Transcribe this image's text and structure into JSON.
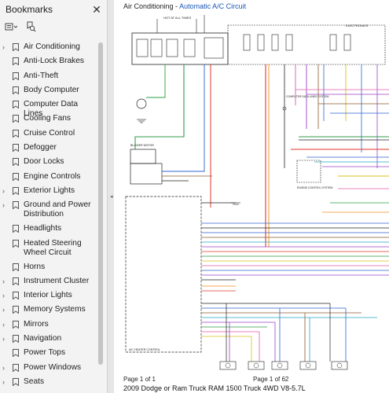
{
  "sidebar": {
    "title": "Bookmarks",
    "items": [
      {
        "label": "Air Conditioning",
        "expand": true
      },
      {
        "label": "Anti-Lock Brakes",
        "expand": false
      },
      {
        "label": "Anti-Theft",
        "expand": false
      },
      {
        "label": "Body Computer",
        "expand": false
      },
      {
        "label": "Computer Data Lines",
        "expand": false
      },
      {
        "label": "Cooling Fans",
        "expand": false
      },
      {
        "label": "Cruise Control",
        "expand": false
      },
      {
        "label": "Defogger",
        "expand": false
      },
      {
        "label": "Door Locks",
        "expand": false
      },
      {
        "label": "Engine Controls",
        "expand": false
      },
      {
        "label": "Exterior Lights",
        "expand": true
      },
      {
        "label": "Ground and Power Distribution",
        "expand": true
      },
      {
        "label": "Headlights",
        "expand": false
      },
      {
        "label": "Heated Steering Wheel Circuit",
        "expand": false
      },
      {
        "label": "Horns",
        "expand": false
      },
      {
        "label": "Instrument Cluster",
        "expand": true
      },
      {
        "label": "Interior Lights",
        "expand": true
      },
      {
        "label": "Memory Systems",
        "expand": true
      },
      {
        "label": "Mirrors",
        "expand": true
      },
      {
        "label": "Navigation",
        "expand": true
      },
      {
        "label": "Power Tops",
        "expand": false
      },
      {
        "label": "Power Windows",
        "expand": true
      },
      {
        "label": "Seats",
        "expand": true
      }
    ]
  },
  "document": {
    "title_main": "Air Conditioning",
    "title_sep": " - ",
    "title_sub": "Automatic A/C Circuit",
    "page_left": "Page 1 of 1",
    "page_center": "Page 1 of 62",
    "caption": "2009 Dodge or Ram Truck RAM 1500 Truck 4WD V8-5.7L"
  },
  "schematic": {
    "labels": {
      "hot_at": "HOT AT ALL TIMES",
      "hot_run": "HOT IN RUN",
      "electronics": "ELECTRONICS",
      "blower_motor": "BLOWER MOTOR",
      "ac_heater_control": "A/C HEATER CONTROL",
      "engine_ctrl": "ENGINE CONTROL SYSTEM",
      "computer_data": "COMPUTER DATA LINES SYSTEM",
      "ground": "GROUND",
      "actuators": [
        "MODE DOOR ACTUATOR",
        "BLEND DOOR ACTUATOR",
        "MODE DOOR ACTUATOR",
        "BLEND DOOR ACTUATOR",
        "RECIRCULATION DOOR"
      ]
    },
    "wire_colors": {
      "red": "#e0362b",
      "green": "#2f9e44",
      "blue": "#2f63d3",
      "violet": "#9b40c9",
      "orange": "#f08a1c",
      "yellow": "#d7c21a",
      "pink": "#e05aa8",
      "cyan": "#23a7c4",
      "brown": "#8a5a2b",
      "black": "#222222"
    }
  }
}
